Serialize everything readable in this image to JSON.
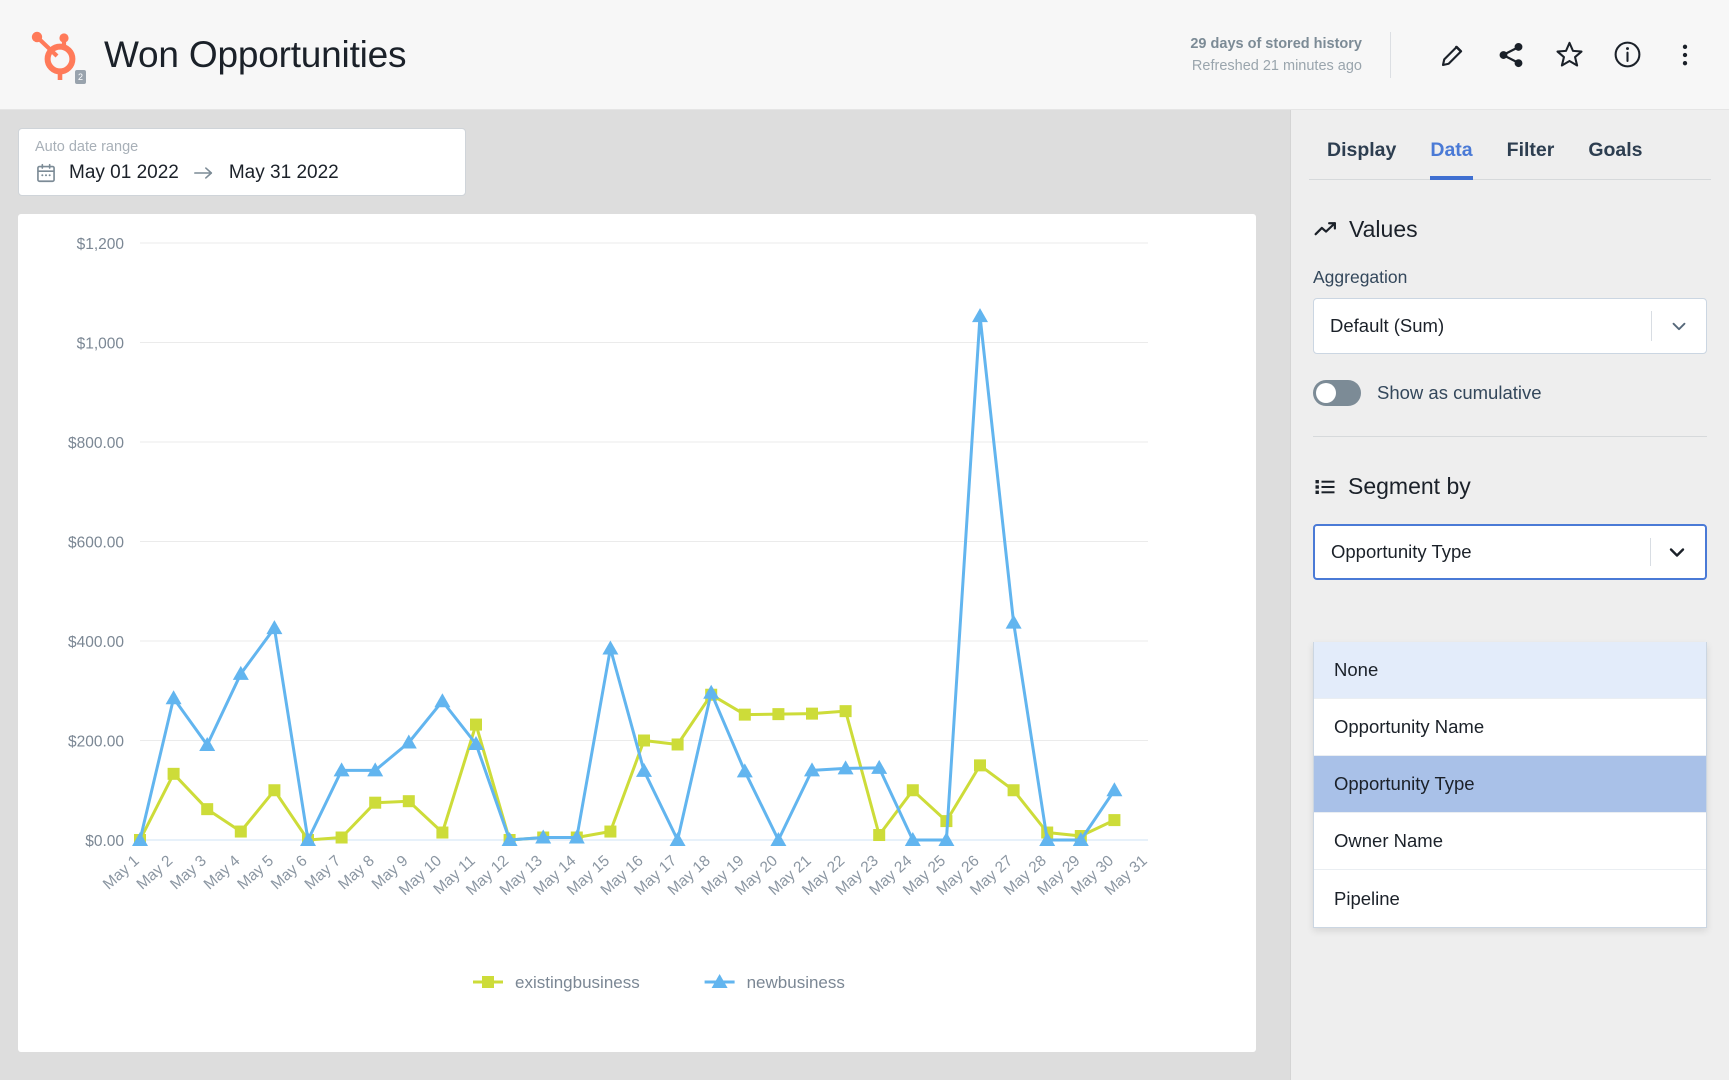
{
  "header": {
    "title": "Won Opportunities",
    "logo_badge": "2",
    "history_main": "29 days of stored history",
    "history_sub": "Refreshed 21 minutes ago",
    "icons": [
      "edit-icon",
      "share-icon",
      "star-icon",
      "info-icon",
      "more-vertical-icon"
    ]
  },
  "daterange": {
    "label": "Auto date range",
    "start": "May 01 2022",
    "end": "May 31 2022"
  },
  "panel": {
    "tabs": [
      {
        "label": "Display",
        "active": false
      },
      {
        "label": "Data",
        "active": true
      },
      {
        "label": "Filter",
        "active": false
      },
      {
        "label": "Goals",
        "active": false
      }
    ],
    "values_section": {
      "title": "Values",
      "aggregation_label": "Aggregation",
      "aggregation_value": "Default (Sum)",
      "cumulative_label": "Show as cumulative",
      "cumulative_on": false
    },
    "segment_section": {
      "title": "Segment by",
      "selected": "Opportunity Type",
      "options": [
        {
          "label": "None",
          "state": "hover"
        },
        {
          "label": "Opportunity Name",
          "state": "normal"
        },
        {
          "label": "Opportunity Type",
          "state": "selected"
        },
        {
          "label": "Owner Name",
          "state": "normal"
        },
        {
          "label": "Pipeline",
          "state": "normal"
        }
      ]
    }
  },
  "colors": {
    "accent_blue": "#3f6fd1",
    "series_existing": "#cddc39",
    "series_new": "#62b5ef",
    "hubspot_orange": "#ff7a59",
    "panel_bg": "#eeeeee",
    "canvas_bg": "#dddddd"
  },
  "chart_data": {
    "type": "line",
    "title": "",
    "xlabel": "",
    "ylabel": "",
    "ylim": [
      0,
      1200
    ],
    "grid": true,
    "legend_position": "bottom",
    "y_ticks": [
      "$0.00",
      "$200.00",
      "$400.00",
      "$600.00",
      "$800.00",
      "$1,000",
      "$1,200"
    ],
    "y_tick_values": [
      0,
      200,
      400,
      600,
      800,
      1000,
      1200
    ],
    "categories": [
      "May 1",
      "May 2",
      "May 3",
      "May 4",
      "May 5",
      "May 6",
      "May 7",
      "May 8",
      "May 9",
      "May 10",
      "May 11",
      "May 12",
      "May 13",
      "May 14",
      "May 15",
      "May 16",
      "May 17",
      "May 18",
      "May 19",
      "May 20",
      "May 21",
      "May 22",
      "May 23",
      "May 24",
      "May 25",
      "May 26",
      "May 27",
      "May 28",
      "May 29",
      "May 30",
      "May 31"
    ],
    "series": [
      {
        "name": "existingbusiness",
        "color": "#cddc39",
        "marker": "square",
        "values": [
          0,
          133,
          62,
          17,
          100,
          0,
          5,
          75,
          78,
          15,
          232,
          0,
          5,
          5,
          17,
          200,
          192,
          292,
          252,
          253,
          254,
          259,
          10,
          100,
          38,
          150,
          100,
          15,
          8,
          40,
          null
        ]
      },
      {
        "name": "newbusiness",
        "color": "#62b5ef",
        "marker": "triangle",
        "values": [
          0,
          285,
          191,
          334,
          426,
          0,
          140,
          140,
          196,
          279,
          193,
          0,
          5,
          5,
          385,
          139,
          0,
          296,
          138,
          0,
          140,
          144,
          145,
          0,
          0,
          1053,
          437,
          0,
          0,
          100,
          null
        ]
      }
    ]
  }
}
